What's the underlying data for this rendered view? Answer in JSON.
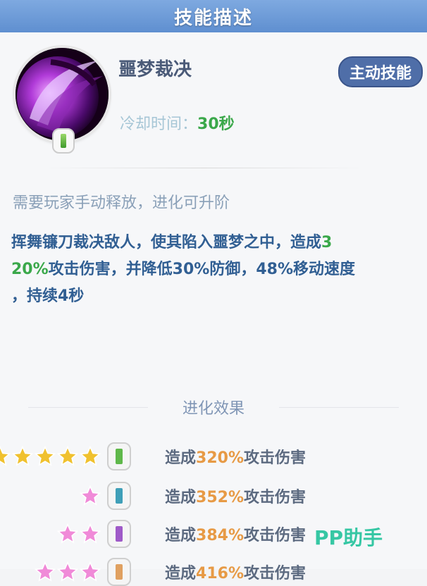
{
  "header": {
    "title": "技能描述"
  },
  "skill": {
    "name": "噩梦裁决",
    "type_badge": "主动技能",
    "cooldown_label": "冷却时间：",
    "cooldown_value": "30秒",
    "hint": "需要玩家手动释放，进化可升阶",
    "desc_part1": "挥舞镰刀裁决敌人，使其陷入噩梦之中，造成",
    "desc_green": "3",
    "desc_green2": "20%",
    "desc_part2": "攻击伤害，并降低30%防御，48%移动速度",
    "desc_part3": "，持续4秒"
  },
  "evolution": {
    "title": "进化效果",
    "rows": [
      {
        "stars": 5,
        "star_color": "#f0c12e",
        "rank_color": "#5fb84a",
        "prefix": "造成",
        "pct": "320%",
        "suffix": "攻击伤害"
      },
      {
        "stars": 1,
        "star_color": "#f08ad8",
        "rank_color": "#3f9fb8",
        "prefix": "造成",
        "pct": "352%",
        "suffix": "攻击伤害"
      },
      {
        "stars": 2,
        "star_color": "#f08ad8",
        "rank_color": "#9f5ac8",
        "prefix": "造成",
        "pct": "384%",
        "suffix": "攻击伤害"
      },
      {
        "stars": 3,
        "star_color": "#f08ad8",
        "rank_color": "#e0a060",
        "prefix": "造成",
        "pct": "416%",
        "suffix": "攻击伤害"
      }
    ]
  },
  "watermark": "PP助手"
}
